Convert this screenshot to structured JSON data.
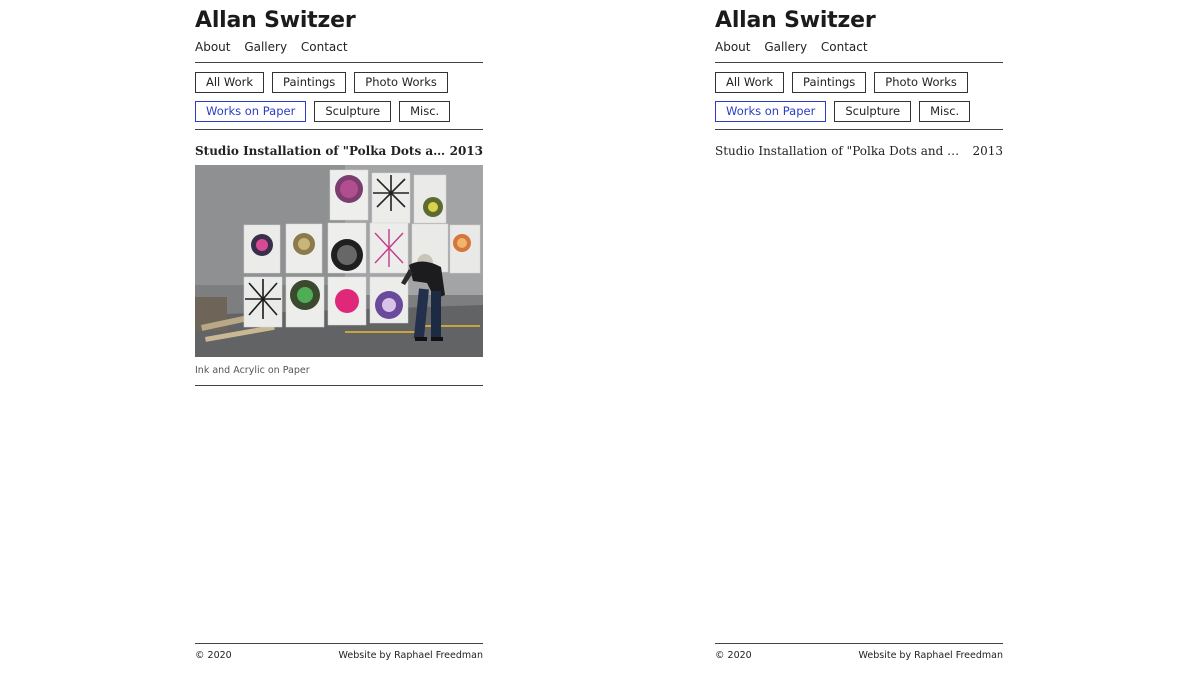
{
  "site": {
    "title": "Allan Switzer",
    "nav": [
      "About",
      "Gallery",
      "Contact"
    ]
  },
  "filters": {
    "row1": [
      "All Work",
      "Paintings",
      "Photo Works"
    ],
    "row2": [
      "Works on Paper",
      "Sculpture",
      "Misc."
    ],
    "active": "Works on Paper"
  },
  "work": {
    "title": "Studio Installation of \"Polka Dots and Stars\"",
    "year": "2013",
    "caption": "Ink and Acrylic on Paper"
  },
  "footer": {
    "copyright": "© 2020",
    "credit": "Website by Raphael Freedman"
  },
  "colors": {
    "accent": "#2b3cc7",
    "text": "#1e1e1e",
    "rule": "#444444"
  }
}
